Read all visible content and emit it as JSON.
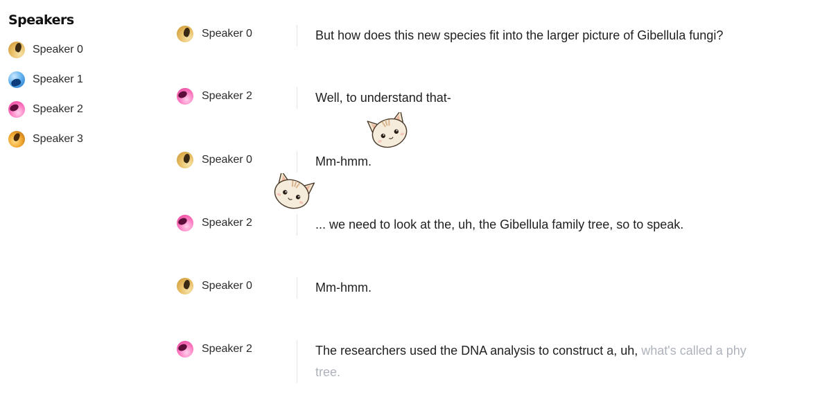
{
  "sidebar": {
    "title": "Speakers",
    "speakers": [
      {
        "label": "Speaker 0",
        "avatar": "gold"
      },
      {
        "label": "Speaker 1",
        "avatar": "blue"
      },
      {
        "label": "Speaker 2",
        "avatar": "pink"
      },
      {
        "label": "Speaker 3",
        "avatar": "amber"
      }
    ]
  },
  "transcript": [
    {
      "speaker": "Speaker 0",
      "avatar": "gold",
      "text": "But how does this new species fit into the larger picture of Gibellula fungi?"
    },
    {
      "speaker": "Speaker 2",
      "avatar": "pink",
      "text": "Well, to understand that-"
    },
    {
      "speaker": "Speaker 0",
      "avatar": "gold",
      "text": "Mm-hmm."
    },
    {
      "speaker": "Speaker 2",
      "avatar": "pink",
      "text": "... we need to look at the, uh, the Gibellula family tree, so to speak."
    },
    {
      "speaker": "Speaker 0",
      "avatar": "gold",
      "text": "Mm-hmm."
    },
    {
      "speaker": "Speaker 2",
      "avatar": "pink",
      "text": "The researchers used the DNA analysis to construct a, uh, ",
      "text_faded": "what's called a phy",
      "text_faded_line2": "tree."
    }
  ],
  "stickers": [
    "cat-sticker",
    "cat-sticker"
  ]
}
